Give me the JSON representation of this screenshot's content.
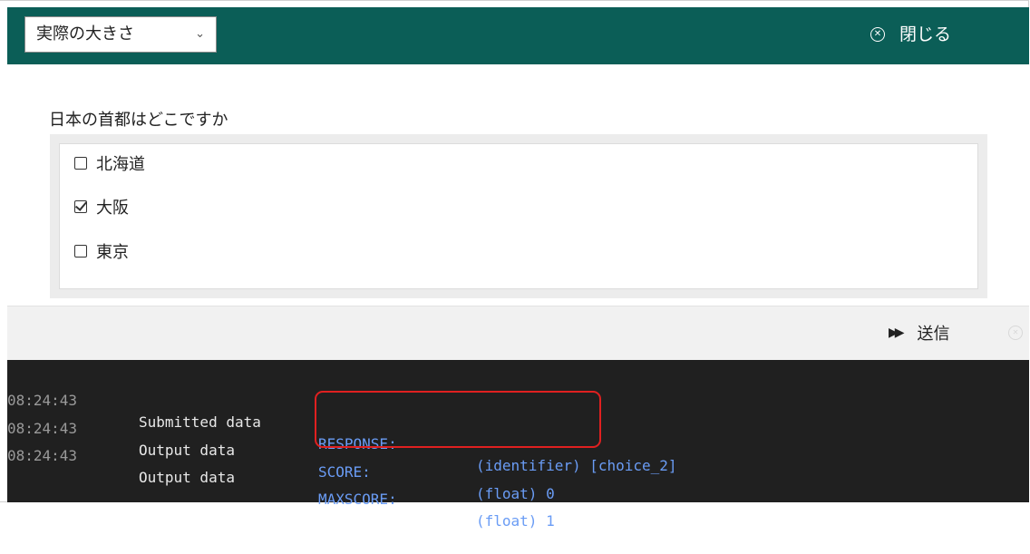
{
  "toolbar": {
    "size_select": {
      "value": "実際の大きさ",
      "chevron": "⌄"
    },
    "close_label": "閉じる",
    "close_icon": "circle-x-icon",
    "bg_color": "#0b5e57"
  },
  "question": {
    "prompt": "日本の首都はどこですか",
    "choices": [
      {
        "label": "北海道",
        "checked": false
      },
      {
        "label": "大阪",
        "checked": true
      },
      {
        "label": "東京",
        "checked": false
      }
    ]
  },
  "footer": {
    "submit_label": "送信",
    "submit_icon": "fast-forward-icon"
  },
  "console": {
    "rows": [
      {
        "time": "08:24:43",
        "label": "Submitted data",
        "key": "RESPONSE:",
        "value": "(identifier) [choice_2]"
      },
      {
        "time": "08:24:43",
        "label": "Output data",
        "key": "SCORE:",
        "value": "(float) 0"
      },
      {
        "time": "08:24:43",
        "label": "Output data",
        "key": "MAXSCORE:",
        "value": "(float) 1"
      }
    ],
    "highlight_color": "#e02020"
  }
}
